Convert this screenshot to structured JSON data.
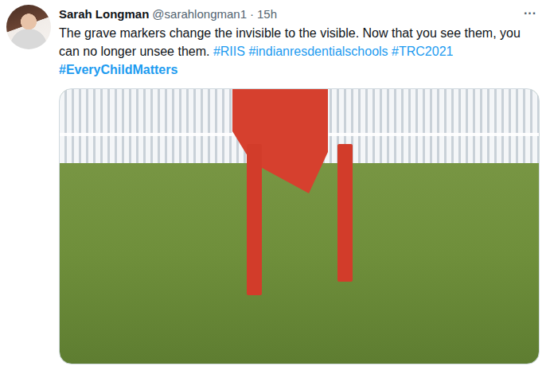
{
  "tweet": {
    "author": {
      "name": "Sarah Longman",
      "handle": "@sarahlongman1",
      "separator": "·",
      "time": "15h"
    },
    "more": "···",
    "body": [
      {
        "text": "The grave markers change the invisible to the visible. Now that you see them, you can no longer unsee them. ",
        "kind": "text",
        "bold": false
      },
      {
        "text": "#RIIS",
        "kind": "hashtag",
        "bold": false
      },
      {
        "text": " ",
        "kind": "text",
        "bold": false
      },
      {
        "text": "#indianresdentialschools",
        "kind": "hashtag",
        "bold": false
      },
      {
        "text": " ",
        "kind": "text",
        "bold": false
      },
      {
        "text": "#TRC2021",
        "kind": "hashtag",
        "bold": false
      },
      {
        "text": " ",
        "kind": "text",
        "bold": false
      },
      {
        "text": "#EveryChildMatters",
        "kind": "hashtag",
        "bold": true
      }
    ]
  }
}
